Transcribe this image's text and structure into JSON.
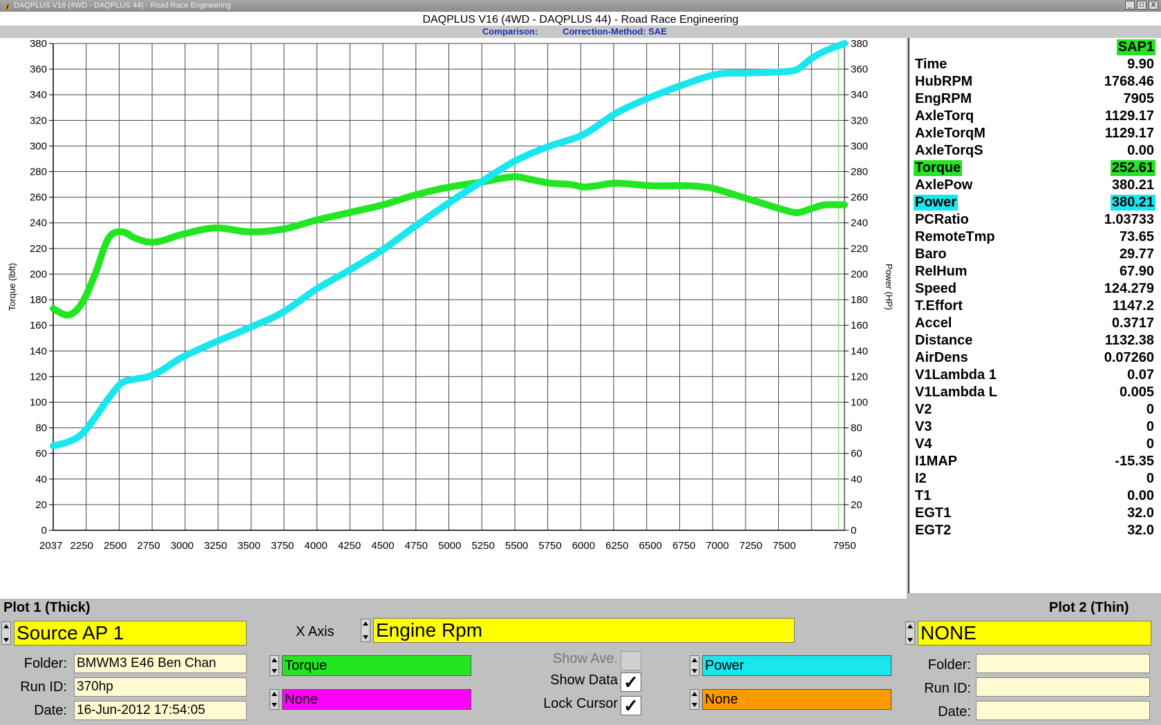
{
  "window": {
    "title": "DAQPLUS V16 (4WD - DAQPLUS 44) - Road Race Engineering",
    "controls": [
      "_",
      "□",
      "X"
    ]
  },
  "heading": {
    "title": "DAQPLUS V16 (4WD - DAQPLUS 44) - Road Race Engineering",
    "comparison_label": "Comparison:",
    "correction_label": "Correction-Method: SAE"
  },
  "colors": {
    "torque": "#22e622",
    "power": "#1ae6ee",
    "highlight_yellow": "#ffff00",
    "none1": "#ff00ff",
    "none2": "#ff9900"
  },
  "chart_data": {
    "type": "line",
    "xlabel": "",
    "ylabel_left": "Torque (lbft)",
    "ylabel_right": "Power (HP)",
    "xlim": [
      2037,
      7950
    ],
    "ylim": [
      0,
      380
    ],
    "x_ticks": [
      "2037",
      "2250",
      "2500",
      "2750",
      "3000",
      "3250",
      "3500",
      "3750",
      "4000",
      "4250",
      "4500",
      "4750",
      "5000",
      "5250",
      "5500",
      "5750",
      "6000",
      "6250",
      "6500",
      "6750",
      "7000",
      "7250",
      "7500",
      "7950"
    ],
    "y_ticks": [
      0,
      20,
      40,
      60,
      80,
      100,
      120,
      140,
      160,
      180,
      200,
      220,
      240,
      260,
      280,
      300,
      320,
      340,
      360,
      380
    ],
    "grid": true,
    "cursor_x": 7905,
    "series": [
      {
        "name": "Torque",
        "x": [
          2037,
          2150,
          2250,
          2350,
          2450,
          2550,
          2650,
          2750,
          2850,
          3000,
          3250,
          3500,
          3750,
          4000,
          4250,
          4500,
          4750,
          5000,
          5250,
          5400,
          5500,
          5600,
          5750,
          5900,
          6000,
          6100,
          6250,
          6500,
          6750,
          6900,
          7000,
          7250,
          7500,
          7600,
          7700,
          7800,
          7950
        ],
        "values": [
          173,
          168,
          177,
          200,
          228,
          233,
          228,
          225,
          226,
          231,
          236,
          233,
          235,
          242,
          248,
          254,
          262,
          268,
          272,
          275,
          276,
          274,
          271,
          270,
          268,
          269,
          271,
          269,
          269,
          268,
          266,
          258,
          250,
          248,
          251,
          254,
          254
        ]
      },
      {
        "name": "Power",
        "x": [
          2037,
          2150,
          2250,
          2350,
          2450,
          2550,
          2650,
          2750,
          2850,
          3000,
          3250,
          3500,
          3750,
          4000,
          4250,
          4500,
          4750,
          5000,
          5250,
          5500,
          5750,
          6000,
          6250,
          6500,
          6750,
          7000,
          7250,
          7500,
          7600,
          7700,
          7800,
          7950
        ],
        "values": [
          66,
          69,
          75,
          88,
          103,
          115,
          118,
          120,
          125,
          135,
          147,
          158,
          170,
          188,
          203,
          219,
          238,
          256,
          273,
          289,
          300,
          309,
          326,
          338,
          348,
          356,
          357,
          358,
          360,
          368,
          374,
          380
        ]
      }
    ]
  },
  "data_panel": {
    "header": "SAP1",
    "rows": [
      {
        "label": "Time",
        "value": "9.90"
      },
      {
        "label": "HubRPM",
        "value": "1768.46"
      },
      {
        "label": "EngRPM",
        "value": "7905"
      },
      {
        "label": "AxleTorq",
        "value": "1129.17"
      },
      {
        "label": "AxleTorqM",
        "value": "1129.17"
      },
      {
        "label": "AxleTorqS",
        "value": "0.00"
      },
      {
        "label": "Torque",
        "value": "252.61",
        "hl": "#22e622"
      },
      {
        "label": "AxlePow",
        "value": "380.21"
      },
      {
        "label": "Power",
        "value": "380.21",
        "hl": "#1ae6ee"
      },
      {
        "label": "PCRatio",
        "value": "1.03733"
      },
      {
        "label": "RemoteTmp",
        "value": "73.65"
      },
      {
        "label": "Baro",
        "value": "29.77"
      },
      {
        "label": "RelHum",
        "value": "67.90"
      },
      {
        "label": "Speed",
        "value": "124.279"
      },
      {
        "label": "T.Effort",
        "value": "1147.2"
      },
      {
        "label": "Accel",
        "value": "0.3717"
      },
      {
        "label": "Distance",
        "value": "1132.38"
      },
      {
        "label": "AirDens",
        "value": "0.07260"
      },
      {
        "label": "V1Lambda 1",
        "value": "0.07"
      },
      {
        "label": "V1Lambda L",
        "value": "0.005"
      },
      {
        "label": "V2",
        "value": "0"
      },
      {
        "label": "V3",
        "value": "0"
      },
      {
        "label": "V4",
        "value": "0"
      },
      {
        "label": "I1MAP",
        "value": "-15.35"
      },
      {
        "label": "I2",
        "value": "0"
      },
      {
        "label": "T1",
        "value": "0.00"
      },
      {
        "label": "EGT1",
        "value": "32.0"
      },
      {
        "label": "EGT2",
        "value": "32.0"
      }
    ]
  },
  "bottom": {
    "plot1_label": "Plot 1 (Thick)",
    "plot2_label": "Plot 2 (Thin)",
    "source1": "Source AP 1",
    "source2": "NONE",
    "xaxis_label": "X Axis",
    "xaxis_value": "Engine Rpm",
    "folder_label": "Folder:",
    "runid_label": "Run ID:",
    "date_label": "Date:",
    "folder1": "BMWM3 E46 Ben Chan",
    "runid1": "370hp",
    "date1": "16-Jun-2012  17:54:05",
    "folder2": "",
    "runid2": "",
    "date2": "",
    "ch1a": "Torque",
    "ch1b": "None",
    "ch2a": "Power",
    "ch2b": "None",
    "show_ave": "Show Ave.",
    "show_data": "Show Data",
    "lock_cursor": "Lock Cursor",
    "show_ave_checked": false,
    "show_data_checked": true,
    "lock_cursor_checked": true
  }
}
